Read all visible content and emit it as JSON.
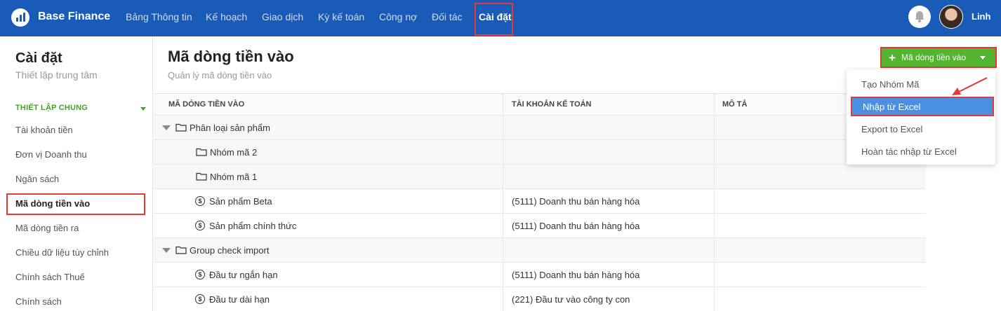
{
  "app": {
    "brand": "Base Finance",
    "user_name": "Linh",
    "nav": [
      {
        "label": "Bảng Thông tin",
        "active": false
      },
      {
        "label": "Kế hoạch",
        "active": false
      },
      {
        "label": "Giao dịch",
        "active": false
      },
      {
        "label": "Kỳ kế toán",
        "active": false
      },
      {
        "label": "Công nợ",
        "active": false
      },
      {
        "label": "Đối tác",
        "active": false
      },
      {
        "label": "Cài đặt",
        "active": true
      }
    ]
  },
  "sidebar": {
    "title": "Cài đặt",
    "subtitle": "Thiết lập trung tâm",
    "section_label": "THIẾT LẬP CHUNG",
    "items": [
      {
        "label": "Tài khoản tiền"
      },
      {
        "label": "Đơn vị Doanh thu"
      },
      {
        "label": "Ngân sách"
      },
      {
        "label": "Mã dòng tiền vào",
        "active": true
      },
      {
        "label": "Mã dòng tiền ra"
      },
      {
        "label": "Chiều dữ liệu tùy chỉnh"
      },
      {
        "label": "Chính sách Thuế"
      },
      {
        "label": "Chính sách"
      }
    ]
  },
  "main": {
    "title": "Mã dòng tiền vào",
    "subtitle": "Quản lý mã dòng tiền vào",
    "add_button_label": "Mã dòng tiền vào",
    "table": {
      "columns": [
        "MÃ DÒNG TIỀN VÀO",
        "TÀI KHOẢN KẾ TOÁN",
        "MÔ TẢ"
      ],
      "rows": [
        {
          "type": "group",
          "name": "Phân loại sản phẩm",
          "account": "",
          "description": ""
        },
        {
          "type": "subgroup",
          "name": "Nhóm mã 2",
          "account": "",
          "description": ""
        },
        {
          "type": "subgroup",
          "name": "Nhóm mã 1",
          "account": "",
          "description": ""
        },
        {
          "type": "code",
          "name": "Sản phẩm Beta",
          "account": "(5111) Doanh thu bán hàng hóa",
          "description": ""
        },
        {
          "type": "code",
          "name": "Sản phẩm chính thức",
          "account": "(5111) Doanh thu bán hàng hóa",
          "description": ""
        },
        {
          "type": "group",
          "name": "Group check import",
          "account": "",
          "description": ""
        },
        {
          "type": "code",
          "name": "Đầu tư ngắn hạn",
          "account": "(5111) Doanh thu bán hàng hóa",
          "description": ""
        },
        {
          "type": "code",
          "name": "Đầu tư dài hạn",
          "account": "(221) Đầu tư vào công ty con",
          "description": ""
        }
      ]
    }
  },
  "dropdown": {
    "items": [
      {
        "label": "Tạo Nhóm Mã"
      },
      {
        "label": "Nhập từ Excel",
        "highlighted": true
      },
      {
        "label": "Export to Excel"
      },
      {
        "label": "Hoàn tác nhập từ Excel"
      }
    ]
  },
  "colors": {
    "nav_bg": "#1a5bb8",
    "accent_green": "#52b42f",
    "highlight_blue": "#4a90e2",
    "annotation_red": "#e53935"
  },
  "icons": {
    "logo": "bar-chart-logo-icon",
    "bell": "bell-icon",
    "folder": "folder-icon",
    "code": "dollar-coin-icon",
    "expand": "triangle-down-icon"
  }
}
